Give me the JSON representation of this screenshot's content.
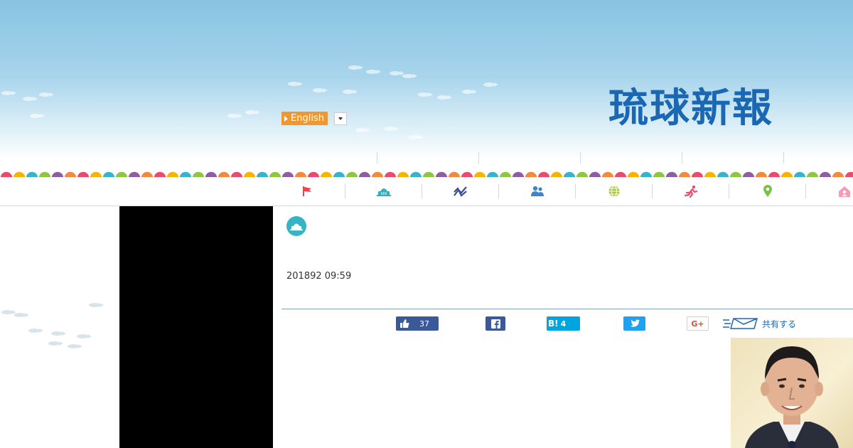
{
  "header": {
    "language_label": "English",
    "logo_text": "琉球新報",
    "subnav": [
      "",
      "",
      "",
      "",
      ""
    ]
  },
  "nav": {
    "items": [
      {
        "name": "flag-icon",
        "color": "#e8454d"
      },
      {
        "name": "government-building-icon",
        "color": "#2fb1c4"
      },
      {
        "name": "economy-chart-icon",
        "color": "#3a4f9c"
      },
      {
        "name": "people-icon",
        "color": "#3f86c8"
      },
      {
        "name": "globe-icon",
        "color": "#a8c93b"
      },
      {
        "name": "runner-icon",
        "color": "#e84a6f"
      },
      {
        "name": "location-pin-icon",
        "color": "#79c142"
      },
      {
        "name": "home-icon",
        "color": "#f29db5"
      }
    ]
  },
  "article": {
    "category_icon": "government-building-icon",
    "date": "201892 09:59"
  },
  "share": {
    "like_count": "37",
    "hatena_label": "B!",
    "hatena_count": "4",
    "gplus_label": "G+",
    "share_label": "共有する",
    "colors": {
      "facebook": "#3b5998",
      "hatena": "#00a4de",
      "twitter": "#1da1f2"
    }
  }
}
